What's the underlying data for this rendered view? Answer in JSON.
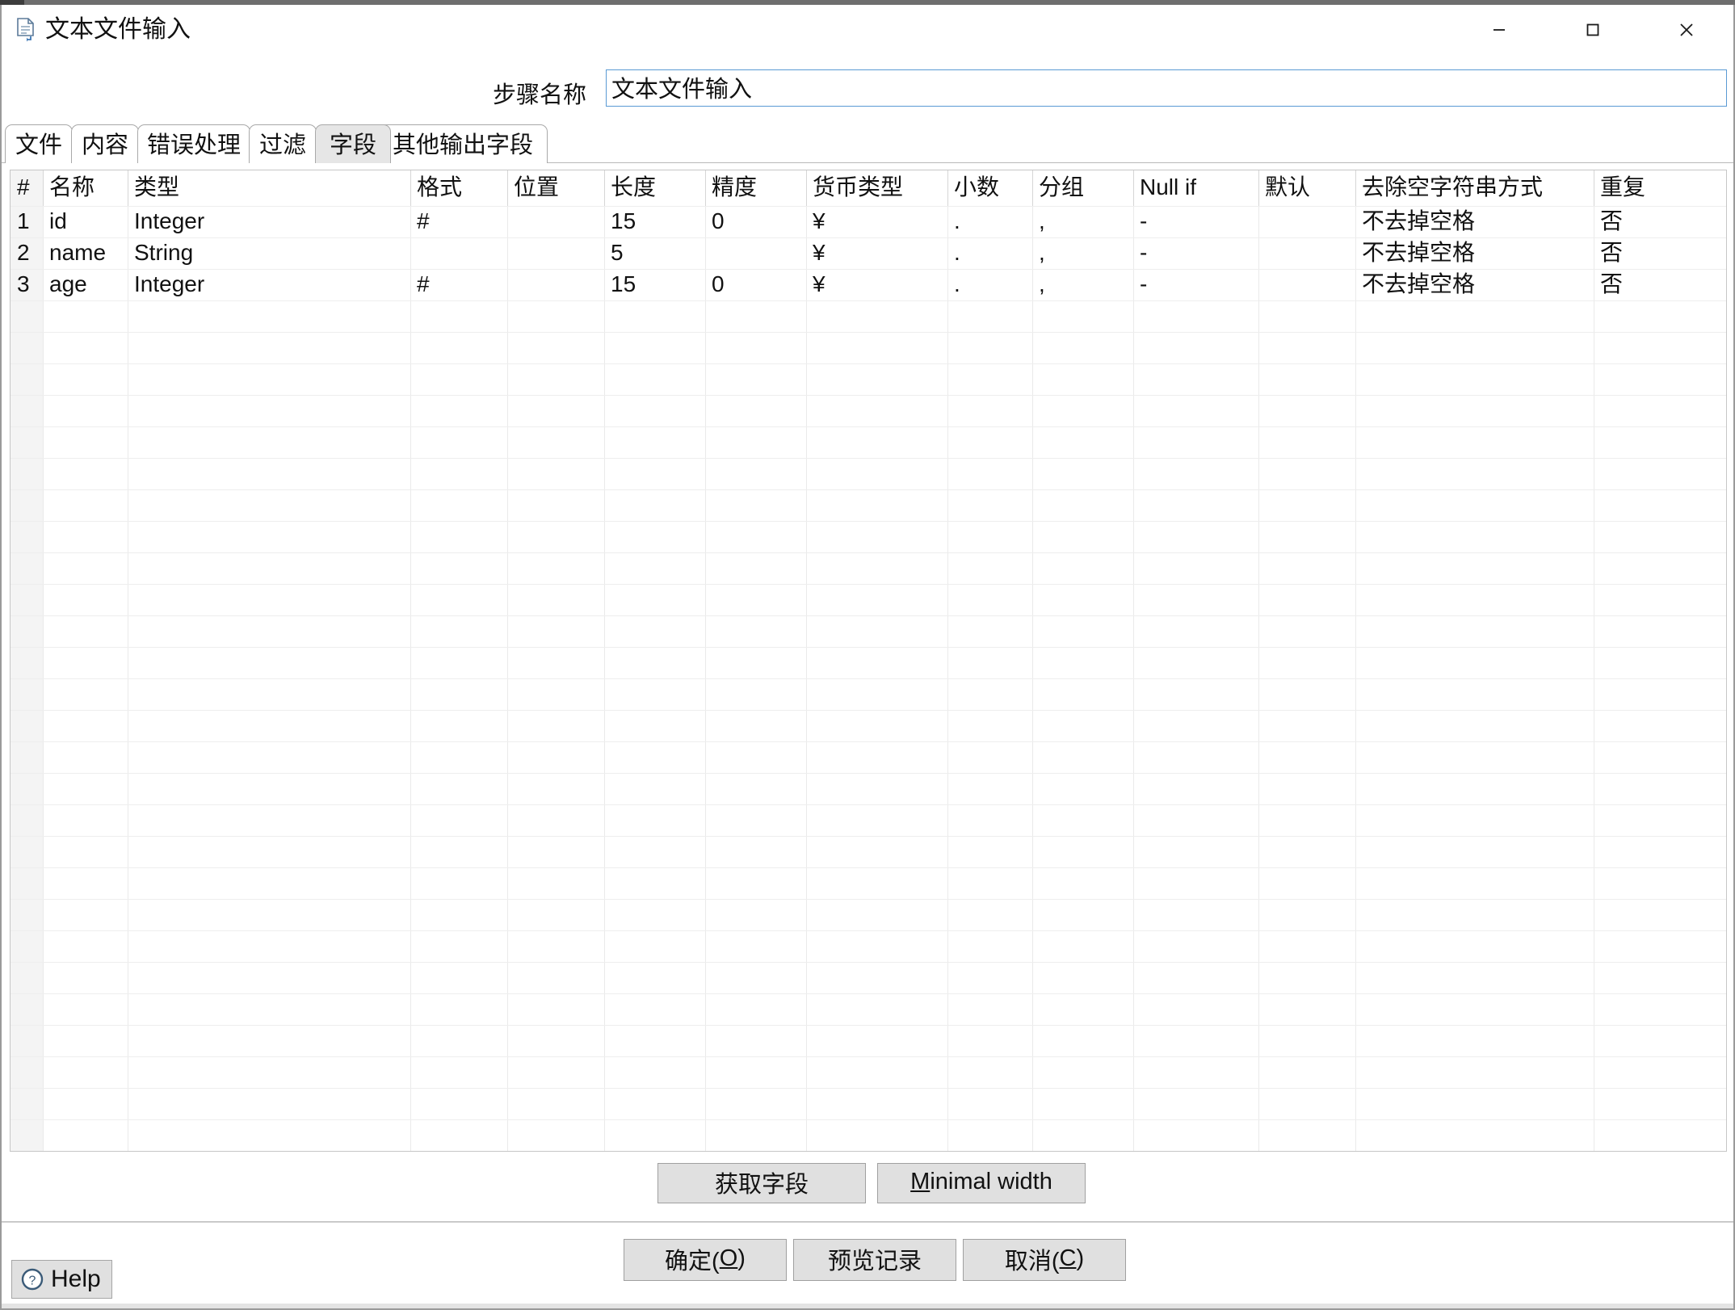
{
  "window": {
    "title": "文本文件输入",
    "icon": "text-file-input-icon",
    "controls": {
      "minimize": "minimize-icon",
      "maximize": "maximize-icon",
      "close": "close-icon"
    }
  },
  "step": {
    "label": "步骤名称",
    "value": "文本文件输入",
    "placeholder": ""
  },
  "tabs": [
    {
      "label": "文件",
      "selected": false
    },
    {
      "label": "内容",
      "selected": false
    },
    {
      "label": "错误处理",
      "selected": false
    },
    {
      "label": "过滤",
      "selected": false
    },
    {
      "label": "字段",
      "selected": true
    },
    {
      "label": "其他输出字段",
      "selected": false
    }
  ],
  "table": {
    "columns": [
      "#",
      "名称",
      "类型",
      "格式",
      "位置",
      "长度",
      "精度",
      "货币类型",
      "小数",
      "分组",
      "Null if",
      "默认",
      "去除空字符串方式",
      "重复"
    ],
    "rows": [
      {
        "num": "1",
        "name": "id",
        "type": "Integer",
        "format": "#",
        "position": "",
        "length": "15",
        "precision": "0",
        "currency": "¥",
        "decimal": ".",
        "group": ",",
        "null_if": "-",
        "default": "",
        "trim": "不去掉空格",
        "repeat": "否"
      },
      {
        "num": "2",
        "name": "name",
        "type": "String",
        "format": "",
        "position": "",
        "length": "5",
        "precision": "",
        "currency": "¥",
        "decimal": ".",
        "group": ",",
        "null_if": "-",
        "default": "",
        "trim": "不去掉空格",
        "repeat": "否"
      },
      {
        "num": "3",
        "name": "age",
        "type": "Integer",
        "format": "#",
        "position": "",
        "length": "15",
        "precision": "0",
        "currency": "¥",
        "decimal": ".",
        "group": ",",
        "null_if": "-",
        "default": "",
        "trim": "不去掉空格",
        "repeat": "否"
      }
    ]
  },
  "mid_buttons": {
    "get_fields": "获取字段",
    "minimal_width_prefix": "M",
    "minimal_width_rest": "inimal width"
  },
  "bottom_buttons": {
    "ok_prefix": "确定(",
    "ok_mnem": "O",
    "ok_suffix": ")",
    "preview": "预览记录",
    "cancel_prefix": "取消(",
    "cancel_mnem": "C",
    "cancel_suffix": ")"
  },
  "help": {
    "label": "Help",
    "icon": "question-circle-icon"
  },
  "colors": {
    "accent": "#5a9ad4",
    "button_face": "#e0e0e0",
    "tab_selected": "#e6e6e6",
    "grid_line": "#eaeaea",
    "rownum_bg": "#f4f4f4"
  }
}
